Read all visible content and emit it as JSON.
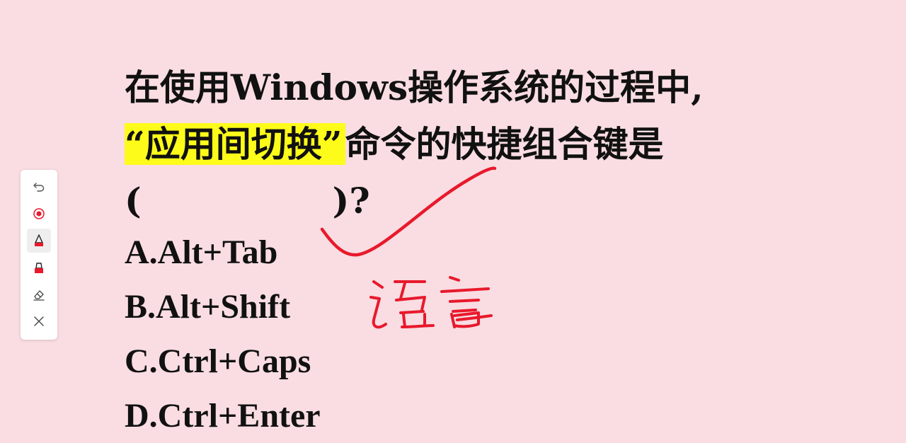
{
  "question": {
    "line1": "在使用Windows操作系统的过程中,",
    "highlight": "“应用间切换”",
    "line2_rest": "命令的快捷组合键是",
    "blank_open": "(",
    "blank_close": ")?"
  },
  "options": [
    "A.Alt+Tab",
    "B.Alt+Shift",
    "C.Ctrl+Caps",
    "D.Ctrl+Enter"
  ],
  "annotation": {
    "handwritten_text": "语言",
    "ink_color": "#e8192c"
  },
  "toolbar": {
    "tools": [
      "undo-icon",
      "record-icon",
      "pen-icon",
      "highlighter-icon",
      "eraser-icon",
      "close-icon"
    ],
    "active_tool": "pen-icon"
  },
  "colors": {
    "background": "#f9dde2",
    "highlight": "#fdfb1a",
    "ink": "#e8192c"
  }
}
